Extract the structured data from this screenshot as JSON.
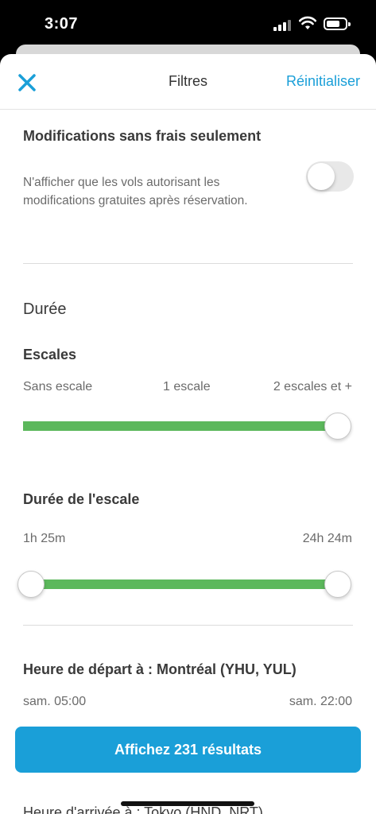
{
  "status_bar": {
    "time": "3:07"
  },
  "header": {
    "title": "Filtres",
    "reset_label": "Réinitialiser"
  },
  "free_changes": {
    "title": "Modifications sans frais seulement",
    "description": "N'afficher que les vols autorisant les modifications gratuites après réservation.",
    "enabled": false
  },
  "duration": {
    "section_title": "Durée",
    "stops": {
      "title": "Escales",
      "labels": [
        "Sans escale",
        "1 escale",
        "2 escales et +"
      ],
      "selected": "2 escales et +"
    },
    "layover": {
      "title": "Durée de l'escale",
      "min_label": "1h 25m",
      "max_label": "24h 24m"
    }
  },
  "departure": {
    "title": "Heure de départ à : Montréal (YHU, YUL)",
    "min_label": "sam. 05:00",
    "max_label": "sam. 22:00"
  },
  "arrival": {
    "title": "Heure d'arrivée à : Tokyo (HND, NRT)"
  },
  "cta": {
    "label": "Affichez 231 résultats"
  },
  "colors": {
    "accent": "#1a9fd8",
    "slider": "#5cb85c"
  }
}
